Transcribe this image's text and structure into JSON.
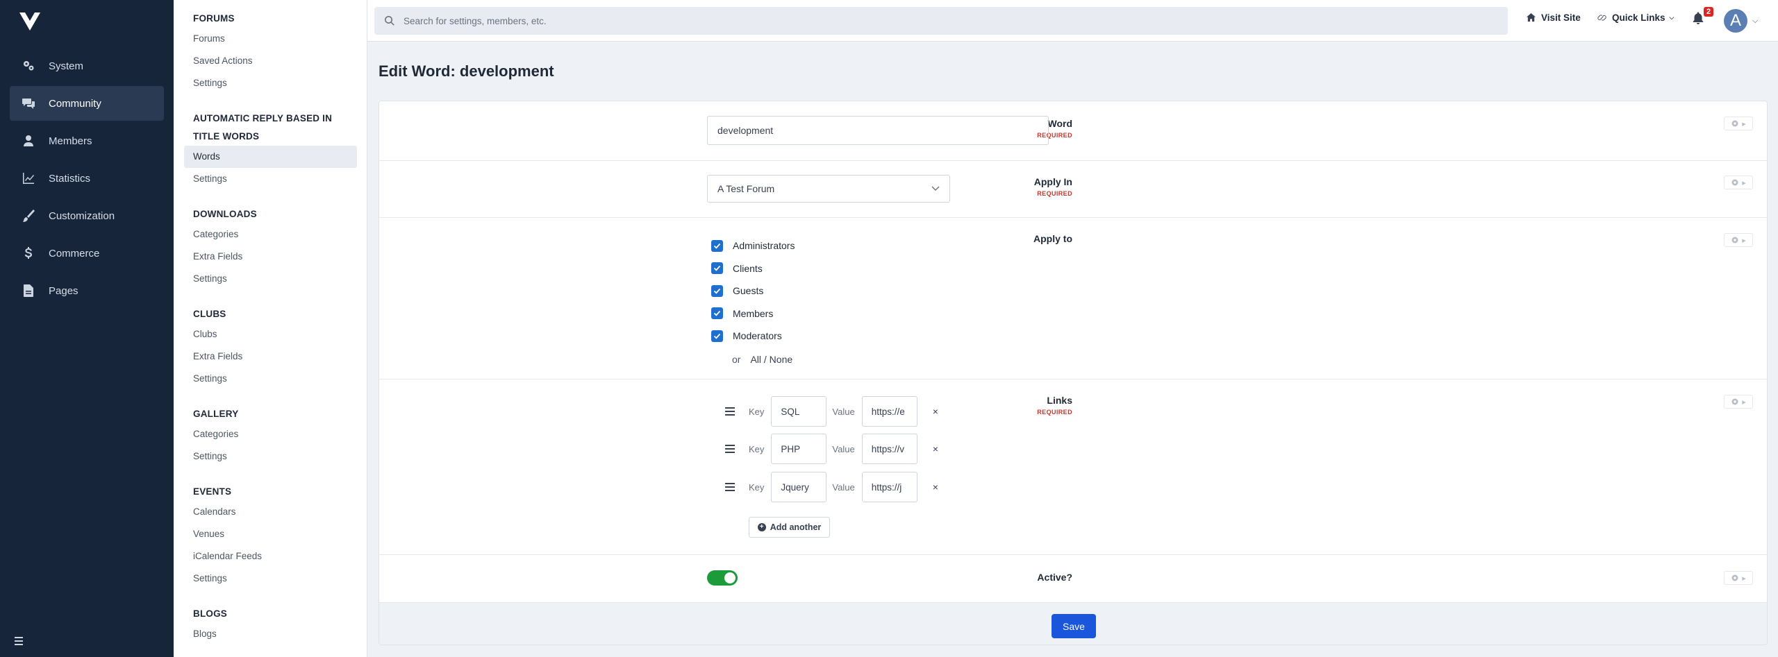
{
  "rail": {
    "items": [
      {
        "label": "System",
        "icon": "gears-icon"
      },
      {
        "label": "Community",
        "icon": "comments-icon",
        "active": true
      },
      {
        "label": "Members",
        "icon": "user-icon"
      },
      {
        "label": "Statistics",
        "icon": "line-chart-icon"
      },
      {
        "label": "Customization",
        "icon": "paintbrush-icon"
      },
      {
        "label": "Commerce",
        "icon": "dollar-icon"
      },
      {
        "label": "Pages",
        "icon": "file-icon"
      }
    ]
  },
  "submenu": {
    "groups": [
      {
        "title": "FORUMS",
        "items": [
          "Forums",
          "Saved Actions",
          "Settings"
        ]
      },
      {
        "title": "AUTOMATIC REPLY BASED IN TITLE WORDS",
        "items": [
          "Words",
          "Settings"
        ],
        "active_item": "Words"
      },
      {
        "title": "DOWNLOADS",
        "items": [
          "Categories",
          "Extra Fields",
          "Settings"
        ]
      },
      {
        "title": "CLUBS",
        "items": [
          "Clubs",
          "Extra Fields",
          "Settings"
        ]
      },
      {
        "title": "GALLERY",
        "items": [
          "Categories",
          "Settings"
        ]
      },
      {
        "title": "EVENTS",
        "items": [
          "Calendars",
          "Venues",
          "iCalendar Feeds",
          "Settings"
        ]
      },
      {
        "title": "BLOGS",
        "items": [
          "Blogs"
        ]
      }
    ]
  },
  "topbar": {
    "search_placeholder": "Search for settings, members, etc.",
    "visit_site": "Visit Site",
    "quick_links": "Quick Links",
    "notification_count": "2",
    "avatar_letter": "A"
  },
  "page": {
    "title": "Edit Word: development"
  },
  "form": {
    "word": {
      "label": "Word",
      "required": "REQUIRED",
      "value": "development"
    },
    "apply_in": {
      "label": "Apply In",
      "required": "REQUIRED",
      "value": "A Test Forum"
    },
    "apply_to": {
      "label": "Apply to",
      "options": [
        "Administrators",
        "Clients",
        "Guests",
        "Members",
        "Moderators"
      ],
      "or": "or",
      "all_none": "All / None"
    },
    "links": {
      "label": "Links",
      "required": "REQUIRED",
      "key_label": "Key",
      "value_label": "Value",
      "rows": [
        {
          "key": "SQL",
          "value": "https://e"
        },
        {
          "key": "PHP",
          "value": "https://v"
        },
        {
          "key": "Jquery",
          "value": "https://j"
        }
      ],
      "remove": "×",
      "add_another": "Add another"
    },
    "active": {
      "label": "Active?",
      "on": true
    },
    "save": "Save"
  },
  "colors": {
    "accent": "#1a56db",
    "toggle_on": "#1d9b3a",
    "checkbox": "#1f6fd1",
    "rail_bg": "#17253a"
  }
}
